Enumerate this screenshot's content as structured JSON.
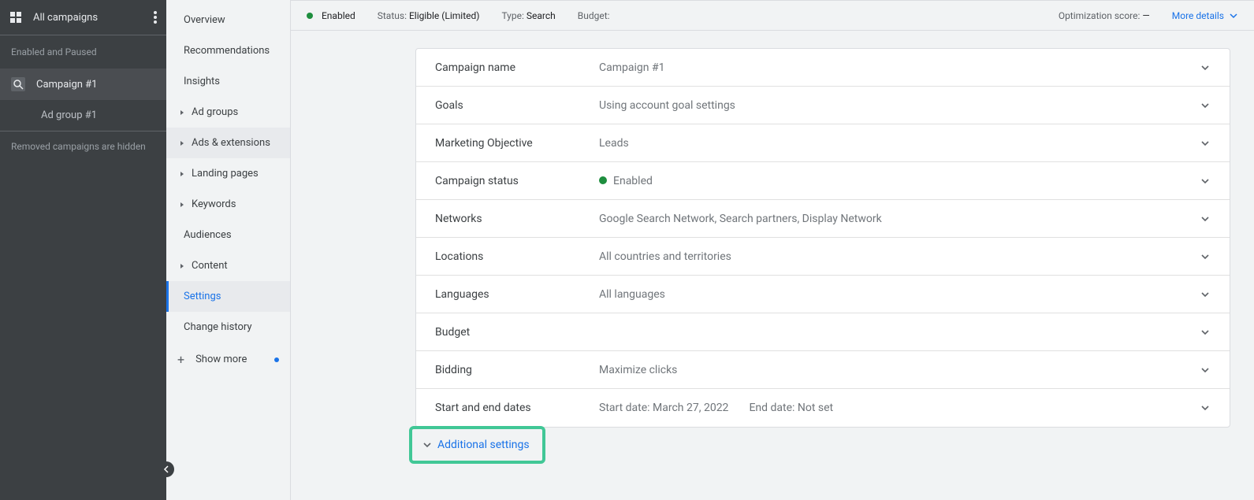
{
  "sidebar_left": {
    "all_campaigns": "All campaigns",
    "filter_label": "Enabled and Paused",
    "campaign_item": "Campaign #1",
    "adgroup_item": "Ad group #1",
    "hidden_note": "Removed campaigns are hidden"
  },
  "sidebar_secondary": {
    "items": [
      "Overview",
      "Recommendations",
      "Insights",
      "Ad groups",
      "Ads & extensions",
      "Landing pages",
      "Keywords",
      "Audiences",
      "Content",
      "Settings",
      "Change history"
    ],
    "show_more": "Show more"
  },
  "statusbar": {
    "enabled": "Enabled",
    "status_label": "Status:",
    "status_value": "Eligible (Limited)",
    "type_label": "Type:",
    "type_value": "Search",
    "budget_label": "Budget:",
    "opt_label": "Optimization score:",
    "opt_value": "—",
    "more_details": "More details"
  },
  "settings_card": {
    "rows": [
      {
        "label": "Campaign name",
        "value": "Campaign #1"
      },
      {
        "label": "Goals",
        "value": "Using account goal settings"
      },
      {
        "label": "Marketing Objective",
        "value": "Leads"
      },
      {
        "label": "Campaign status",
        "value": "Enabled",
        "status_dot": true
      },
      {
        "label": "Networks",
        "value": "Google Search Network, Search partners, Display Network"
      },
      {
        "label": "Locations",
        "value": "All countries and territories"
      },
      {
        "label": "Languages",
        "value": "All languages"
      },
      {
        "label": "Budget",
        "value": ""
      },
      {
        "label": "Bidding",
        "value": "Maximize clicks"
      },
      {
        "label": "Start and end dates",
        "start": "Start date: March 27, 2022",
        "end": "End date: Not set"
      }
    ],
    "additional_settings": "Additional settings"
  }
}
